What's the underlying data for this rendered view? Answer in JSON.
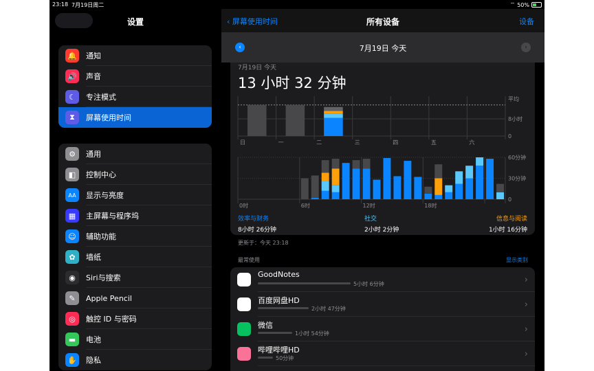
{
  "status_bar": {
    "time": "23:18",
    "date": "7月19日周二",
    "wifi": "wifi-icon",
    "battery": "50%"
  },
  "sidebar": {
    "title": "设置",
    "groups": [
      {
        "items": [
          {
            "label": "通知",
            "icon": "bell-icon",
            "color": "#ff3b30",
            "glyph": "🔔"
          },
          {
            "label": "声音",
            "icon": "speaker-icon",
            "color": "#ff2d55",
            "glyph": "🔊"
          },
          {
            "label": "专注模式",
            "icon": "moon-icon",
            "color": "#5e5ce6",
            "glyph": "☾"
          },
          {
            "label": "屏幕使用时间",
            "icon": "hourglass-icon",
            "color": "#5e5ce6",
            "glyph": "⧗",
            "selected": true
          }
        ]
      },
      {
        "items": [
          {
            "label": "通用",
            "icon": "gear-icon",
            "color": "#8e8e93",
            "glyph": "⚙"
          },
          {
            "label": "控制中心",
            "icon": "toggles-icon",
            "color": "#8e8e93",
            "glyph": "◧"
          },
          {
            "label": "显示与亮度",
            "icon": "text-size-icon",
            "color": "#0a84ff",
            "glyph": "AA"
          },
          {
            "label": "主屏幕与程序坞",
            "icon": "grid-icon",
            "color": "#3a3aff",
            "glyph": "▦"
          },
          {
            "label": "辅助功能",
            "icon": "accessibility-icon",
            "color": "#0a84ff",
            "glyph": "☺"
          },
          {
            "label": "墙纸",
            "icon": "flower-icon",
            "color": "#30b0c7",
            "glyph": "✿"
          },
          {
            "label": "Siri与搜索",
            "icon": "siri-icon",
            "color": "#2c2c2e",
            "glyph": "◉"
          },
          {
            "label": "Apple Pencil",
            "icon": "pencil-icon",
            "color": "#8e8e93",
            "glyph": "✎"
          },
          {
            "label": "触控 ID 与密码",
            "icon": "fingerprint-icon",
            "color": "#ff2d55",
            "glyph": "◎"
          },
          {
            "label": "电池",
            "icon": "battery-icon",
            "color": "#34c759",
            "glyph": "▬"
          },
          {
            "label": "隐私",
            "icon": "hand-icon",
            "color": "#0a84ff",
            "glyph": "✋"
          }
        ]
      }
    ]
  },
  "nav": {
    "back_label": "屏幕使用时间",
    "title": "所有设备",
    "devices_label": "设备"
  },
  "date_bar": {
    "date": "7月19日 今天"
  },
  "summary": {
    "date": "7月19日 今天",
    "total": "13 小时 32 分钟",
    "updated": "更新于：今天 23:18"
  },
  "chart_data": [
    {
      "type": "bar",
      "categories": [
        "日",
        "一",
        "二",
        "三",
        "四",
        "五",
        "六"
      ],
      "series": [
        {
          "values": [
            14.5,
            14.5,
            13.53,
            0,
            0,
            0,
            0
          ]
        }
      ],
      "y_tick_labels": [
        "8小时",
        "0"
      ],
      "avg_label": "平均",
      "avg_value": 14.5,
      "stack_colors": [
        "#0a84ff",
        "#5ac8fa",
        "#ff9f0a",
        "#636366"
      ],
      "current_day_stack": [
        8.43,
        2.03,
        1.27,
        1.79
      ]
    },
    {
      "type": "bar",
      "x_tick_labels": [
        "0时",
        "6时",
        "12时",
        "18时"
      ],
      "y_tick_labels": [
        "60分钟",
        "30分钟",
        "0"
      ],
      "ylim": [
        0,
        60
      ],
      "hours": [
        {
          "h": 0,
          "blue": 0,
          "cyan": 0,
          "orange": 0,
          "gray": 0
        },
        {
          "h": 1,
          "blue": 0,
          "cyan": 0,
          "orange": 0,
          "gray": 0
        },
        {
          "h": 2,
          "blue": 0,
          "cyan": 0,
          "orange": 0,
          "gray": 0
        },
        {
          "h": 3,
          "blue": 0,
          "cyan": 0,
          "orange": 0,
          "gray": 0
        },
        {
          "h": 4,
          "blue": 0,
          "cyan": 0,
          "orange": 0,
          "gray": 0
        },
        {
          "h": 5,
          "blue": 0,
          "cyan": 0,
          "orange": 0,
          "gray": 0
        },
        {
          "h": 6,
          "blue": 0,
          "cyan": 0,
          "orange": 0,
          "gray": 30
        },
        {
          "h": 7,
          "blue": 2,
          "cyan": 0,
          "orange": 0,
          "gray": 32
        },
        {
          "h": 8,
          "blue": 12,
          "cyan": 14,
          "orange": 12,
          "gray": 18
        },
        {
          "h": 9,
          "blue": 10,
          "cyan": 10,
          "orange": 24,
          "gray": 14
        },
        {
          "h": 10,
          "blue": 52,
          "cyan": 0,
          "orange": 0,
          "gray": 0
        },
        {
          "h": 11,
          "blue": 44,
          "cyan": 0,
          "orange": 0,
          "gray": 12
        },
        {
          "h": 12,
          "blue": 44,
          "cyan": 0,
          "orange": 0,
          "gray": 14
        },
        {
          "h": 13,
          "blue": 28,
          "cyan": 0,
          "orange": 0,
          "gray": 0
        },
        {
          "h": 14,
          "blue": 59,
          "cyan": 0,
          "orange": 0,
          "gray": 0
        },
        {
          "h": 15,
          "blue": 33,
          "cyan": 0,
          "orange": 0,
          "gray": 0
        },
        {
          "h": 16,
          "blue": 55,
          "cyan": 0,
          "orange": 0,
          "gray": 0
        },
        {
          "h": 17,
          "blue": 32,
          "cyan": 0,
          "orange": 0,
          "gray": 0
        },
        {
          "h": 18,
          "blue": 8,
          "cyan": 0,
          "orange": 0,
          "gray": 10
        },
        {
          "h": 19,
          "blue": 6,
          "cyan": 0,
          "orange": 24,
          "gray": 20
        },
        {
          "h": 20,
          "blue": 10,
          "cyan": 10,
          "orange": 0,
          "gray": 0
        },
        {
          "h": 21,
          "blue": 22,
          "cyan": 18,
          "orange": 0,
          "gray": 0
        },
        {
          "h": 22,
          "blue": 30,
          "cyan": 18,
          "orange": 0,
          "gray": 0
        },
        {
          "h": 23,
          "blue": 48,
          "cyan": 12,
          "orange": 0,
          "gray": 0
        },
        {
          "h": 24,
          "blue": 58,
          "cyan": 0,
          "orange": 0,
          "gray": 0
        },
        {
          "h": 25,
          "blue": 0,
          "cyan": 10,
          "orange": 0,
          "gray": 12
        }
      ]
    }
  ],
  "categories_summary": [
    {
      "label": "效率与财务",
      "time": "8小时 26分钟",
      "color": "#0a84ff"
    },
    {
      "label": "社交",
      "time": "2小时 2分钟",
      "color": "#5ac8fa"
    },
    {
      "label": "信息与阅读",
      "time": "1小时 16分钟",
      "color": "#ff9f0a"
    }
  ],
  "most_used": {
    "title": "最常使用",
    "show_categories": "显示类别",
    "apps": [
      {
        "name": "GoodNotes",
        "time": "5小时 6分钟",
        "fraction": 1.0,
        "icon": "goodnotes-icon",
        "color": "#ffffff"
      },
      {
        "name": "百度网盘HD",
        "time": "2小时 47分钟",
        "fraction": 0.55,
        "icon": "baidu-pan-icon",
        "color": "#ffffff"
      },
      {
        "name": "微信",
        "time": "1小时 54分钟",
        "fraction": 0.37,
        "icon": "wechat-icon",
        "color": "#07c160"
      },
      {
        "name": "哔哩哔哩HD",
        "time": "50分钟",
        "fraction": 0.16,
        "icon": "bilibili-icon",
        "color": "#fb7299"
      }
    ]
  }
}
